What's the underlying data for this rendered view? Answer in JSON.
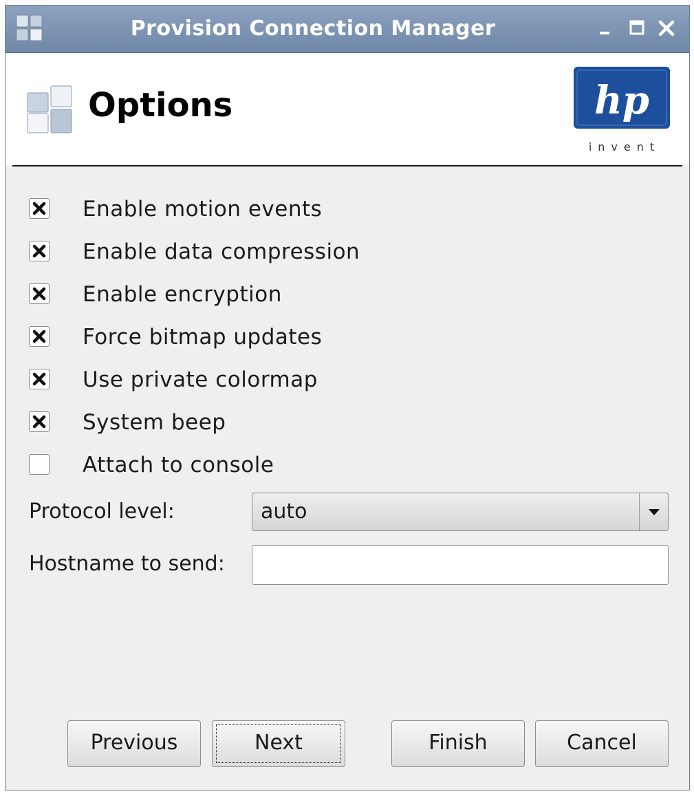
{
  "window": {
    "title": "Provision Connection Manager"
  },
  "header": {
    "title": "Options",
    "logo_text": "hp",
    "logo_tagline": "invent"
  },
  "options": [
    {
      "label": "Enable motion events",
      "checked": true
    },
    {
      "label": "Enable data compression",
      "checked": true
    },
    {
      "label": "Enable encryption",
      "checked": true
    },
    {
      "label": "Force bitmap updates",
      "checked": true
    },
    {
      "label": "Use private colormap",
      "checked": true
    },
    {
      "label": "System beep",
      "checked": true
    },
    {
      "label": "Attach to console",
      "checked": false
    }
  ],
  "protocol": {
    "label": "Protocol level:",
    "value": "auto"
  },
  "hostname": {
    "label": "Hostname to send:",
    "value": ""
  },
  "buttons": {
    "previous": "Previous",
    "next": "Next",
    "finish": "Finish",
    "cancel": "Cancel"
  },
  "colors": {
    "titlebar": "#7d94b4",
    "logo_blue": "#1d4f9c"
  }
}
